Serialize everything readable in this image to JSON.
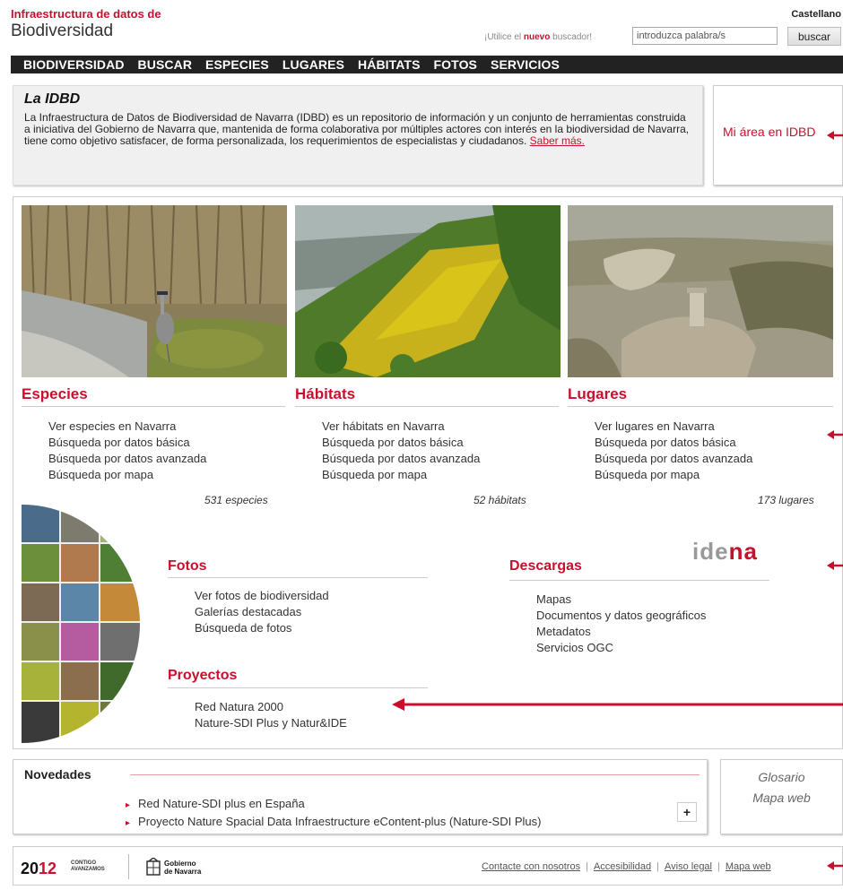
{
  "header": {
    "brand_line1": "Infraestructura de datos de",
    "brand_line2": "Biodiversidad",
    "language": "Castellano",
    "search_hint_pre": "¡Utilice el ",
    "search_hint_bold": "nuevo",
    "search_hint_post": " buscador!",
    "search_placeholder": "introduzca palabra/s",
    "search_button": "buscar"
  },
  "nav": [
    "BIODIVERSIDAD",
    "BUSCAR",
    "ESPECIES",
    "LUGARES",
    "HÁBITATS",
    "FOTOS",
    "SERVICIOS"
  ],
  "intro": {
    "title": "La IDBD",
    "body": "La Infraestructura de Datos de Biodiversidad de Navarra (IDBD) es un repositorio de información y un conjunto de herramientas construida a iniciativa del Gobierno de Navarra que, mantenida de forma colaborativa por múltiples actores con interés en la biodiversidad de Navarra, tiene como objetivo satisfacer, de forma personalizada, los requerimientos de especialistas y ciudadanos. ",
    "link": "Saber más."
  },
  "my_area": "Mi área en IDBD",
  "columns": [
    {
      "title": "Especies",
      "links": [
        "Ver especies en Navarra",
        "Búsqueda por datos básica",
        "Búsqueda por datos avanzada",
        "Búsqueda por mapa"
      ],
      "count": "531 especies"
    },
    {
      "title": "Hábitats",
      "links": [
        "Ver hábitats en Navarra",
        "Búsqueda por datos básica",
        "Búsqueda por datos avanzada",
        "Búsqueda por mapa"
      ],
      "count": "52 hábitats"
    },
    {
      "title": "Lugares",
      "links": [
        "Ver lugares en Navarra",
        "Búsqueda por datos básica",
        "Búsqueda por datos avanzada",
        "Búsqueda por mapa"
      ],
      "count": "173 lugares"
    }
  ],
  "fotos": {
    "title": "Fotos",
    "links": [
      "Ver fotos de biodiversidad",
      "Galerías destacadas",
      "Búsqueda de fotos"
    ]
  },
  "descargas": {
    "title": "Descargas",
    "links": [
      "Mapas",
      "Documentos y datos geográficos",
      "Metadatos",
      "Servicios OGC"
    ],
    "logo_text_a": "ide",
    "logo_text_b": "na"
  },
  "proyectos": {
    "title": "Proyectos",
    "links": [
      "Red Natura 2000",
      "Nature-SDI Plus y Natur&IDE"
    ]
  },
  "novedades": {
    "title": "Novedades",
    "items": [
      "Red Nature-SDI plus en España",
      "Proyecto Nature Spacial Data Infraestructure eContent-plus (Nature-SDI Plus)"
    ],
    "more": "+"
  },
  "side_links": [
    "Glosario",
    "Mapa web"
  ],
  "footer": {
    "year_a": "20",
    "year_b": "12",
    "year_sub1": "CONTIGO",
    "year_sub2": "AVANZAMOS",
    "gov1": "Gobierno",
    "gov2": "de Navarra",
    "links": [
      "Contacte con nosotros",
      "Accesibilidad",
      "Aviso legal",
      "Mapa web"
    ]
  },
  "colors": {
    "accent": "#c8102e",
    "nav_bg": "#222222"
  }
}
